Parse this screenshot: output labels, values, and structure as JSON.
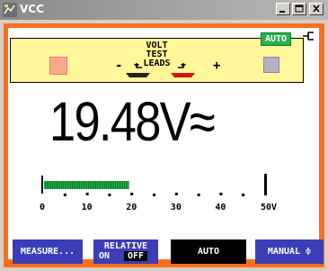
{
  "window": {
    "title": "VCC"
  },
  "titlebar_buttons": {
    "minimize": "minimize-icon",
    "maximize": "maximize-icon",
    "close": "close-icon"
  },
  "panel": {
    "line1": "VOLT",
    "line2": "TEST",
    "line3": "LEADS",
    "minus": "-",
    "plus": "+",
    "badge": "AUTO"
  },
  "reading": {
    "value": "19.48",
    "unit": "V",
    "symbol": "≈"
  },
  "bargraph": {
    "scale_labels": [
      "0",
      "10",
      "20",
      "30",
      "40",
      "50V"
    ],
    "max": 50,
    "value": 19.48,
    "fill_color": "#21b24a"
  },
  "softkeys": {
    "measure": "MEASURE...",
    "relative_top": "RELATIVE",
    "relative_on": "ON",
    "relative_off": "OFF",
    "auto": "AUTO",
    "manual": "MANUAL ≑"
  },
  "colors": {
    "frame": "#fb6e1b",
    "panel": "#fff799",
    "softkey": "#3b3eb8",
    "badge": "#28b24b"
  }
}
